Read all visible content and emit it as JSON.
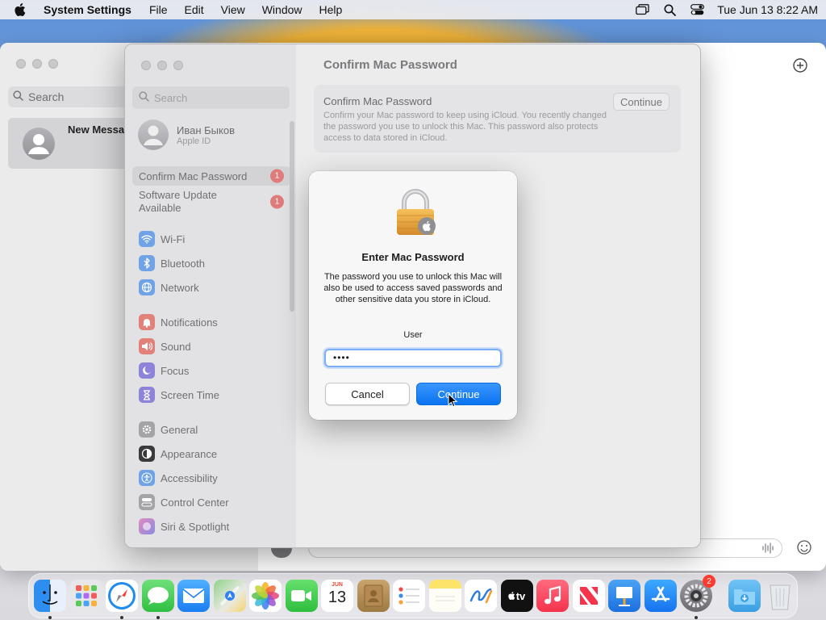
{
  "menubar": {
    "app_name": "System Settings",
    "menus": [
      "File",
      "Edit",
      "View",
      "Window",
      "Help"
    ],
    "clock": "Tue Jun 13  8:22 AM"
  },
  "messages": {
    "search_placeholder": "Search",
    "conversation_name": "New Messag"
  },
  "settings": {
    "window_title": "Confirm Mac Password",
    "search_placeholder": "Search",
    "user": {
      "name": "Иван Быков",
      "subtitle": "Apple ID"
    },
    "sidebar_items": [
      {
        "label": "Confirm Mac Password",
        "badge": "1",
        "icon": "confirm-password-icon",
        "color": "#e2e2e4"
      },
      {
        "label": "Software Update Available",
        "badge": "1",
        "icon": "software-update-icon",
        "color": "#e2e2e4"
      },
      {
        "label": "Wi-Fi",
        "icon": "wifi-icon",
        "color": "#6fa3e6"
      },
      {
        "label": "Bluetooth",
        "icon": "bluetooth-icon",
        "color": "#6fa3e6"
      },
      {
        "label": "Network",
        "icon": "network-icon",
        "color": "#6fa3e6"
      },
      {
        "label": "Notifications",
        "icon": "notifications-icon",
        "color": "#e2817a"
      },
      {
        "label": "Sound",
        "icon": "sound-icon",
        "color": "#e2817a"
      },
      {
        "label": "Focus",
        "icon": "focus-icon",
        "color": "#8c84d9"
      },
      {
        "label": "Screen Time",
        "icon": "screen-time-icon",
        "color": "#8c84d9"
      },
      {
        "label": "General",
        "icon": "general-icon",
        "color": "#a4a4a8"
      },
      {
        "label": "Appearance",
        "icon": "appearance-icon",
        "color": "#3a3a3c"
      },
      {
        "label": "Accessibility",
        "icon": "accessibility-icon",
        "color": "#6fa3e6"
      },
      {
        "label": "Control Center",
        "icon": "control-center-icon",
        "color": "#a4a4a8"
      },
      {
        "label": "Siri & Spotlight",
        "icon": "siri-icon",
        "color": "#b08ad6"
      }
    ],
    "card": {
      "title": "Confirm Mac Password",
      "description": "Confirm your Mac password to keep using iCloud. You recently changed the password you use to unlock this Mac. This password also protects access to data stored in iCloud.",
      "button": "Continue"
    }
  },
  "dialog": {
    "title": "Enter Mac Password",
    "body": "The password you use to unlock this Mac will also be used to access saved passwords and other sensitive data you store in iCloud.",
    "field_label": "User",
    "password_value": "••••",
    "cancel": "Cancel",
    "continue": "Continue"
  },
  "dock": {
    "calendar": {
      "month": "JUN",
      "day": "13"
    },
    "tv_label": "tv",
    "settings_badge": "2",
    "apps": [
      "Finder",
      "Launchpad",
      "Safari",
      "Messages",
      "Mail",
      "Maps",
      "Photos",
      "FaceTime",
      "Calendar",
      "Contacts",
      "Reminders",
      "Notes",
      "Freeform",
      "TV",
      "Music",
      "News",
      "Keynote",
      "App Store",
      "System Settings",
      "Downloads",
      "Trash"
    ]
  }
}
